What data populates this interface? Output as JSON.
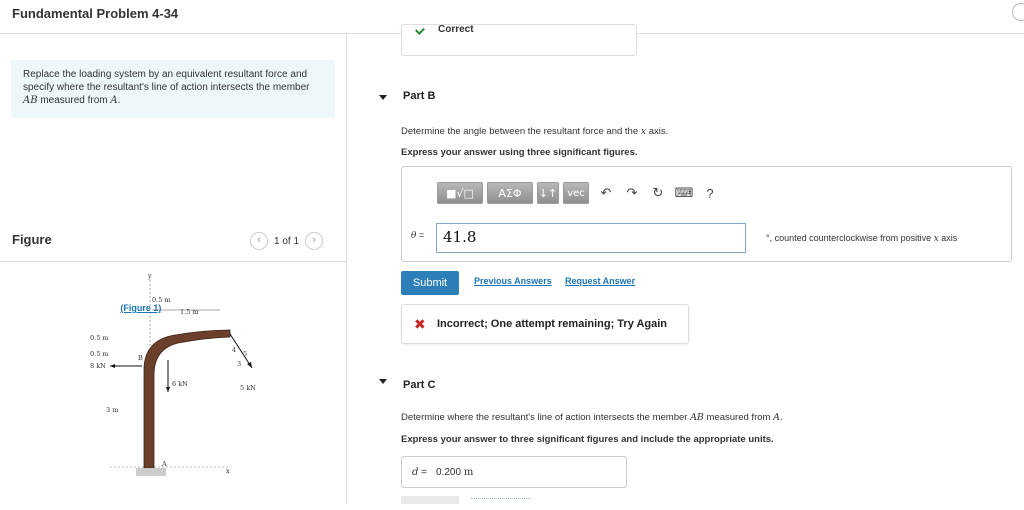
{
  "header": {
    "title": "Fundamental Problem 4-34"
  },
  "problem": {
    "text_pre": "Replace the loading system by an equivalent resultant force and specify where the resultant's line of action intersects the member ",
    "member": "AB",
    "text_mid": " measured from ",
    "point": "A",
    "text_post": ". ",
    "figure_link": "(Figure 1)"
  },
  "figure_panel": {
    "label": "Figure",
    "pager_text": "1 of 1",
    "labels": {
      "y": "y",
      "x": "x",
      "B": "B",
      "A": "A",
      "dim_05": "0.5 m",
      "dim_15": "1.5 m",
      "left_05a": "0.5 m",
      "left_05b": "0.5 m",
      "kn8": "8 kN",
      "kn6": "6 kN",
      "kn5": "5 kN",
      "dim_3m": "3 m",
      "tri_4": "4",
      "tri_3": "3",
      "tri_5": "5"
    }
  },
  "part_a": {
    "status": "Correct"
  },
  "part_b": {
    "heading": "Part B",
    "question_pre": "Determine the angle between the resultant force and the ",
    "question_var": "x",
    "question_post": " axis.",
    "instruction": "Express your answer using three significant figures.",
    "toolbar": {
      "templates": "■√□",
      "greek": "ΑΣΦ",
      "arrows": "↓↑",
      "vec": "vec",
      "undo": "↶",
      "redo": "↷",
      "reset": "↻",
      "keyboard": "⌨",
      "help": "?"
    },
    "var_symbol": "θ",
    "equals": " =",
    "answer": "41.8",
    "unit_pre": "°, counted counterclockwise from positive ",
    "unit_var": "x",
    "unit_post": " axis",
    "submit_label": "Submit",
    "previous_answers": "Previous Answers",
    "request_answer": "Request Answer",
    "feedback_icon": "✖",
    "feedback": "Incorrect; One attempt remaining; Try Again"
  },
  "part_c": {
    "heading": "Part C",
    "question_pre": "Determine where the resultant's line of action intersects the member ",
    "question_member": "AB",
    "question_mid": " measured from ",
    "question_point": "A",
    "question_post": ".",
    "instruction": "Express your answer to three significant figures and include the appropriate units.",
    "var_symbol": "d",
    "equals": " =",
    "value": "0.200",
    "unit": "m"
  },
  "colors": {
    "link": "#1b75bb",
    "submit": "#2e7fb8",
    "error": "#c62828",
    "success": "#2b8a3e",
    "problem_bg": "#eef7fa"
  }
}
